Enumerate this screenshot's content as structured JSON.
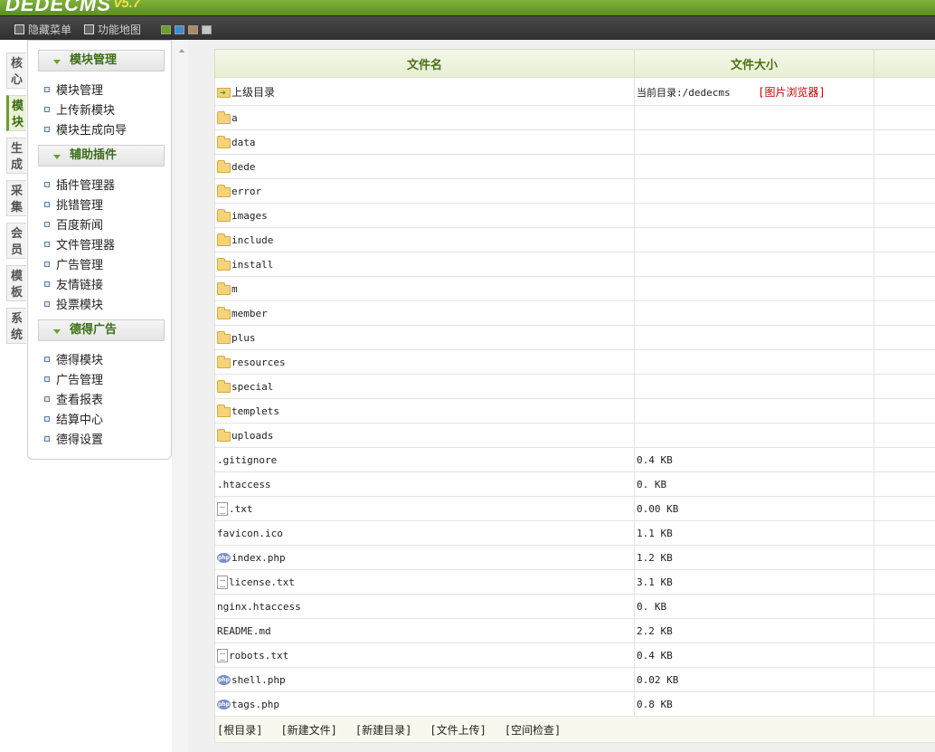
{
  "brand": {
    "logo": "DEDECMS",
    "version": "v5.7"
  },
  "topbar": {
    "hide_menu": "隐藏菜单",
    "func_map": "功能地图"
  },
  "theme_swatches": [
    "#6aa12a",
    "#3d8fd1",
    "#a98b6a",
    "#c7c7c7"
  ],
  "vtabs": [
    "核心",
    "模块",
    "生成",
    "采集",
    "会员",
    "模板",
    "系统"
  ],
  "sidebar": {
    "sections": [
      {
        "title": "模块管理",
        "items": [
          "模块管理",
          "上传新模块",
          "模块生成向导"
        ]
      },
      {
        "title": "辅助插件",
        "items": [
          "插件管理器",
          "挑错管理",
          "百度新闻",
          "文件管理器",
          "广告管理",
          "友情链接",
          "投票模块"
        ]
      },
      {
        "title": "德得广告",
        "items": [
          "德得模块",
          "广告管理",
          "查看报表",
          "结算中心",
          "德得设置"
        ]
      }
    ]
  },
  "table": {
    "headers": {
      "name": "文件名",
      "size": "文件大小"
    },
    "parent": {
      "label": "上级目录",
      "current_dir": "当前目录:/dedecms",
      "image_browser": "[图片浏览器]"
    },
    "folders": [
      "a",
      "data",
      "dede",
      "error",
      "images",
      "include",
      "install",
      "m",
      "member",
      "plus",
      "resources",
      "special",
      "templets",
      "uploads"
    ],
    "files": [
      {
        "name": ".gitignore",
        "size": "0.4 KB",
        "icon": "none"
      },
      {
        "name": ".htaccess",
        "size": "0. KB",
        "icon": "none"
      },
      {
        "name": ".txt",
        "size": "0.00 KB",
        "icon": "txt"
      },
      {
        "name": "favicon.ico",
        "size": "1.1 KB",
        "icon": "none"
      },
      {
        "name": "index.php",
        "size": "1.2 KB",
        "icon": "php"
      },
      {
        "name": "license.txt",
        "size": "3.1 KB",
        "icon": "txt"
      },
      {
        "name": "nginx.htaccess",
        "size": "0. KB",
        "icon": "none"
      },
      {
        "name": "README.md",
        "size": "2.2 KB",
        "icon": "none"
      },
      {
        "name": "robots.txt",
        "size": "0.4 KB",
        "icon": "txt"
      },
      {
        "name": "shell.php",
        "size": "0.02 KB",
        "icon": "php"
      },
      {
        "name": "tags.php",
        "size": "0.8 KB",
        "icon": "php"
      }
    ],
    "footer_links": [
      "[根目录]",
      "[新建文件]",
      "[新建目录]",
      "[文件上传]",
      "[空间检查]"
    ]
  }
}
